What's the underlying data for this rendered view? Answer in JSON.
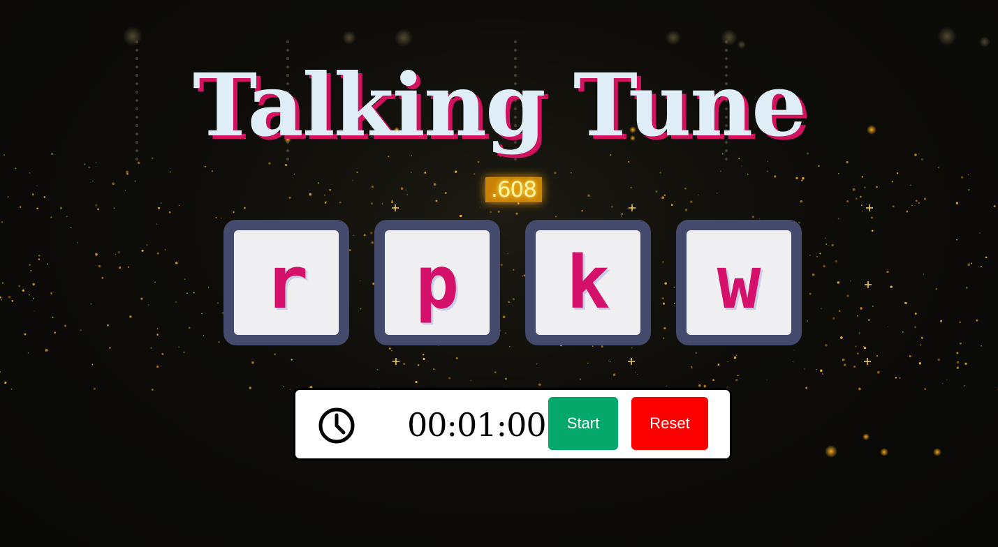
{
  "title": "Talking Tune",
  "background_counter": ".608",
  "tiles": [
    {
      "letter": "r"
    },
    {
      "letter": "p"
    },
    {
      "letter": "k"
    },
    {
      "letter": "w"
    }
  ],
  "timer": {
    "icon": "clock-icon",
    "display": "00:01:00",
    "start_label": "Start",
    "reset_label": "Reset"
  },
  "colors": {
    "title_text": "#dfeef6",
    "title_shadow": "#d3125f",
    "tile_frame": "#434a6b",
    "tile_face": "#efeff1",
    "tile_letter": "#d4106a",
    "start_button": "#05a86b",
    "reset_button": "#fc0000"
  }
}
